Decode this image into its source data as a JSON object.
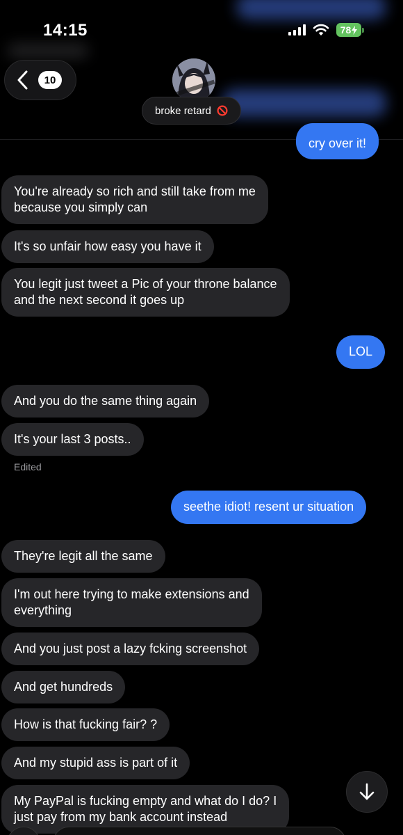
{
  "status_bar": {
    "time": "14:15",
    "battery": "78",
    "icons": [
      "signal-icon",
      "wifi-icon",
      "battery-icon",
      "charging-bolt-icon"
    ]
  },
  "header": {
    "back_icon": "chevron-left-icon",
    "unread_count": "10",
    "contact_name": "broke retard",
    "name_icon": "prohibited-icon"
  },
  "messages": [
    {
      "id": "m0",
      "dir": "out",
      "text": "cry over it!"
    },
    {
      "id": "m1",
      "dir": "in",
      "lines": [
        "You're already so rich and still take from me",
        "because you simply can"
      ]
    },
    {
      "id": "m2",
      "dir": "in",
      "text": "It's so unfair how easy you have it"
    },
    {
      "id": "m3",
      "dir": "in",
      "lines": [
        "You legit just tweet a Pic of your throne balance",
        "and the next second it goes up"
      ]
    },
    {
      "id": "m4",
      "dir": "out",
      "text": "LOL"
    },
    {
      "id": "m5",
      "dir": "in",
      "text": "And you do the same thing again"
    },
    {
      "id": "m6",
      "dir": "in",
      "text": "It's your last 3 posts..",
      "edited": "Edited"
    },
    {
      "id": "m7",
      "dir": "out",
      "text": "seethe idiot! resent ur situation"
    },
    {
      "id": "m8",
      "dir": "in",
      "text": "They're legit all the same"
    },
    {
      "id": "m9",
      "dir": "in",
      "lines": [
        "I'm out here trying to make extensions and",
        "everything"
      ]
    },
    {
      "id": "m10",
      "dir": "in",
      "text": "And you just post a lazy fcking screenshot"
    },
    {
      "id": "m11",
      "dir": "in",
      "text": "And get hundreds"
    },
    {
      "id": "m12",
      "dir": "in",
      "text": "How is that fucking fair? ?"
    },
    {
      "id": "m13",
      "dir": "in",
      "text": "And my stupid ass is part of it"
    },
    {
      "id": "m14",
      "dir": "in",
      "lines": [
        "My PayPal is fucking empty and what do I do? I",
        "just pay from my bank account instead"
      ]
    }
  ],
  "scroll_button_icon": "arrow-down-icon",
  "colors": {
    "background": "#000000",
    "incoming_bubble": "#262629",
    "outgoing_bubble": "#3477f2",
    "battery": "#63c35f"
  }
}
